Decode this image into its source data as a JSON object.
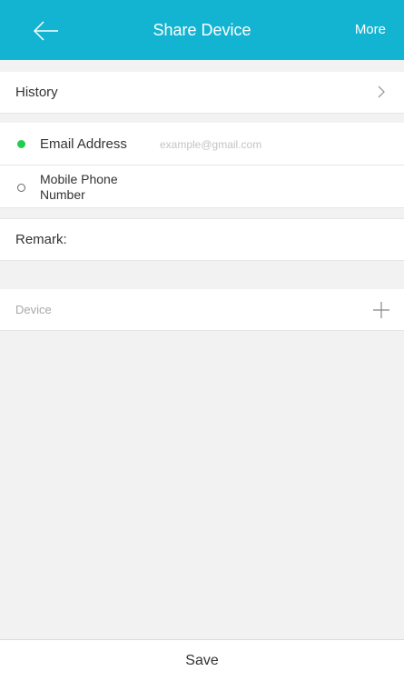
{
  "header": {
    "title": "Share Device",
    "back_icon": "arrow-left-icon",
    "more_label": "More",
    "background_color": "#13b4d2"
  },
  "history": {
    "label": "History",
    "chevron_icon": "chevron-right-icon"
  },
  "share_method": {
    "selected": "email",
    "email": {
      "label": "Email Address",
      "placeholder": "example@gmail.com",
      "value": ""
    },
    "phone": {
      "label": "Mobile Phone Number"
    },
    "selected_color": "#1fce4f"
  },
  "remark": {
    "label": "Remark:",
    "value": ""
  },
  "device": {
    "label": "Device",
    "add_icon": "plus-icon"
  },
  "footer": {
    "save_label": "Save"
  }
}
